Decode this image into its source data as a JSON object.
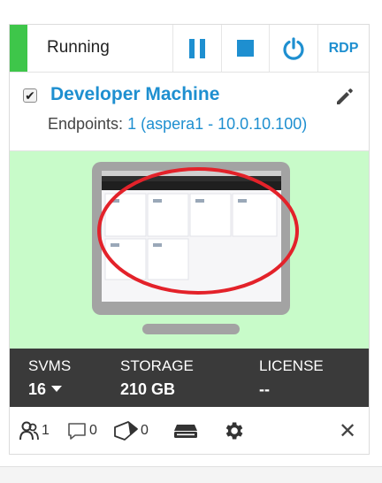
{
  "toolbar": {
    "status": "Running",
    "status_color": "#3ec64a",
    "accent": "#1e8fd0",
    "pause_icon": "pause-icon",
    "stop_icon": "stop-icon",
    "power_icon": "power-icon",
    "rdp_label": "RDP"
  },
  "machine": {
    "checked": true,
    "name": "Developer Machine",
    "endpoints_label": "Endpoints:",
    "endpoints_value": "1 (aspera1 - 10.0.10.100)",
    "edit_icon": "pencil-icon"
  },
  "stats": {
    "svms_label": "SVMS",
    "svms_value": "16",
    "storage_label": "STORAGE",
    "storage_value": "210 GB",
    "license_label": "LICENSE",
    "license_value": "--"
  },
  "actions": {
    "users_count": "1",
    "comments_count": "0",
    "tags_count": "0",
    "icons": [
      "users-icon",
      "comment-icon",
      "tag-icon",
      "drive-icon",
      "gear-icon",
      "close-icon"
    ]
  }
}
